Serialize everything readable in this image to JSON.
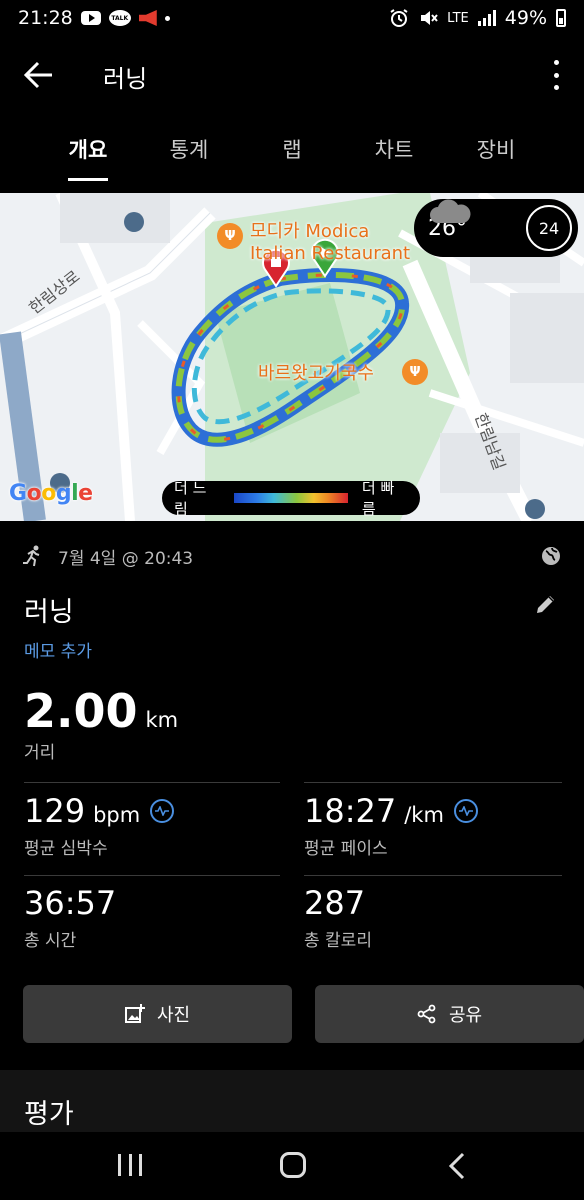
{
  "status_bar": {
    "time": "21:28",
    "talk_label": "TALK",
    "network": "LTE",
    "battery": "49%"
  },
  "app_bar": {
    "title": "러닝"
  },
  "tabs": [
    {
      "label": "개요",
      "active": true
    },
    {
      "label": "통계",
      "active": false
    },
    {
      "label": "랩",
      "active": false
    },
    {
      "label": "차트",
      "active": false
    },
    {
      "label": "장비",
      "active": false
    }
  ],
  "map": {
    "poi_top": "모디카 Modica",
    "poi_top_line2": "Italian Restaurant",
    "poi_mid": "바르왓고기국수",
    "road_left": "한림상로",
    "road_right": "한림남길",
    "weather": {
      "temp": "26°",
      "index": "24"
    },
    "legend": {
      "slow": "더 느림",
      "fast": "더 빠름"
    },
    "google": "Google",
    "colors": {
      "slow": "#1a47c8",
      "mid": "#8cc63f",
      "fast": "#d7242f"
    }
  },
  "activity": {
    "date": "7월 4일 @ 20:43",
    "title": "러닝",
    "memo": "메모 추가",
    "distance": {
      "value": "2.00",
      "unit": "km",
      "label": "거리"
    },
    "heart_rate": {
      "value": "129",
      "unit": "bpm",
      "label": "평균 심박수"
    },
    "pace": {
      "value": "18:27",
      "unit": "/km",
      "label": "평균 페이스"
    },
    "duration": {
      "value": "36:57",
      "label": "총 시간"
    },
    "calories": {
      "value": "287",
      "label": "총 칼로리"
    }
  },
  "actions": {
    "photo": "사진",
    "share": "공유"
  },
  "rating": {
    "title": "평가"
  }
}
